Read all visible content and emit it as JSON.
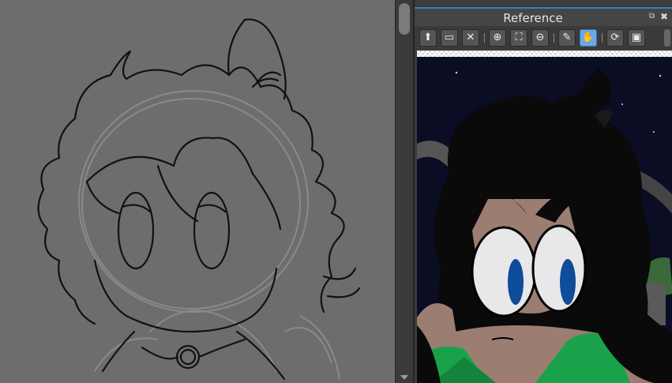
{
  "panel": {
    "title": "Reference",
    "pop_out_icon": "pop-out-icon",
    "close_icon": "close-icon"
  },
  "toolbar": {
    "buttons": [
      {
        "name": "import-icon",
        "glyph": "⬆"
      },
      {
        "name": "open-folder-icon",
        "glyph": "▭"
      },
      {
        "name": "clear-icon",
        "glyph": "✕"
      },
      {
        "name": "zoom-in-icon",
        "glyph": "⊕"
      },
      {
        "name": "fit-icon",
        "glyph": "⛶"
      },
      {
        "name": "zoom-out-icon",
        "glyph": "⊖"
      },
      {
        "name": "eyedropper-icon",
        "glyph": "✎"
      },
      {
        "name": "hand-icon",
        "glyph": "✋",
        "active": true
      },
      {
        "name": "rotate-icon",
        "glyph": "⟳"
      },
      {
        "name": "fullscreen-icon",
        "glyph": "▣"
      }
    ]
  },
  "colors": {
    "canvas_bg": "#6d6d6d",
    "accent": "#3a78c8",
    "active_tool": "#6aa8e8"
  }
}
